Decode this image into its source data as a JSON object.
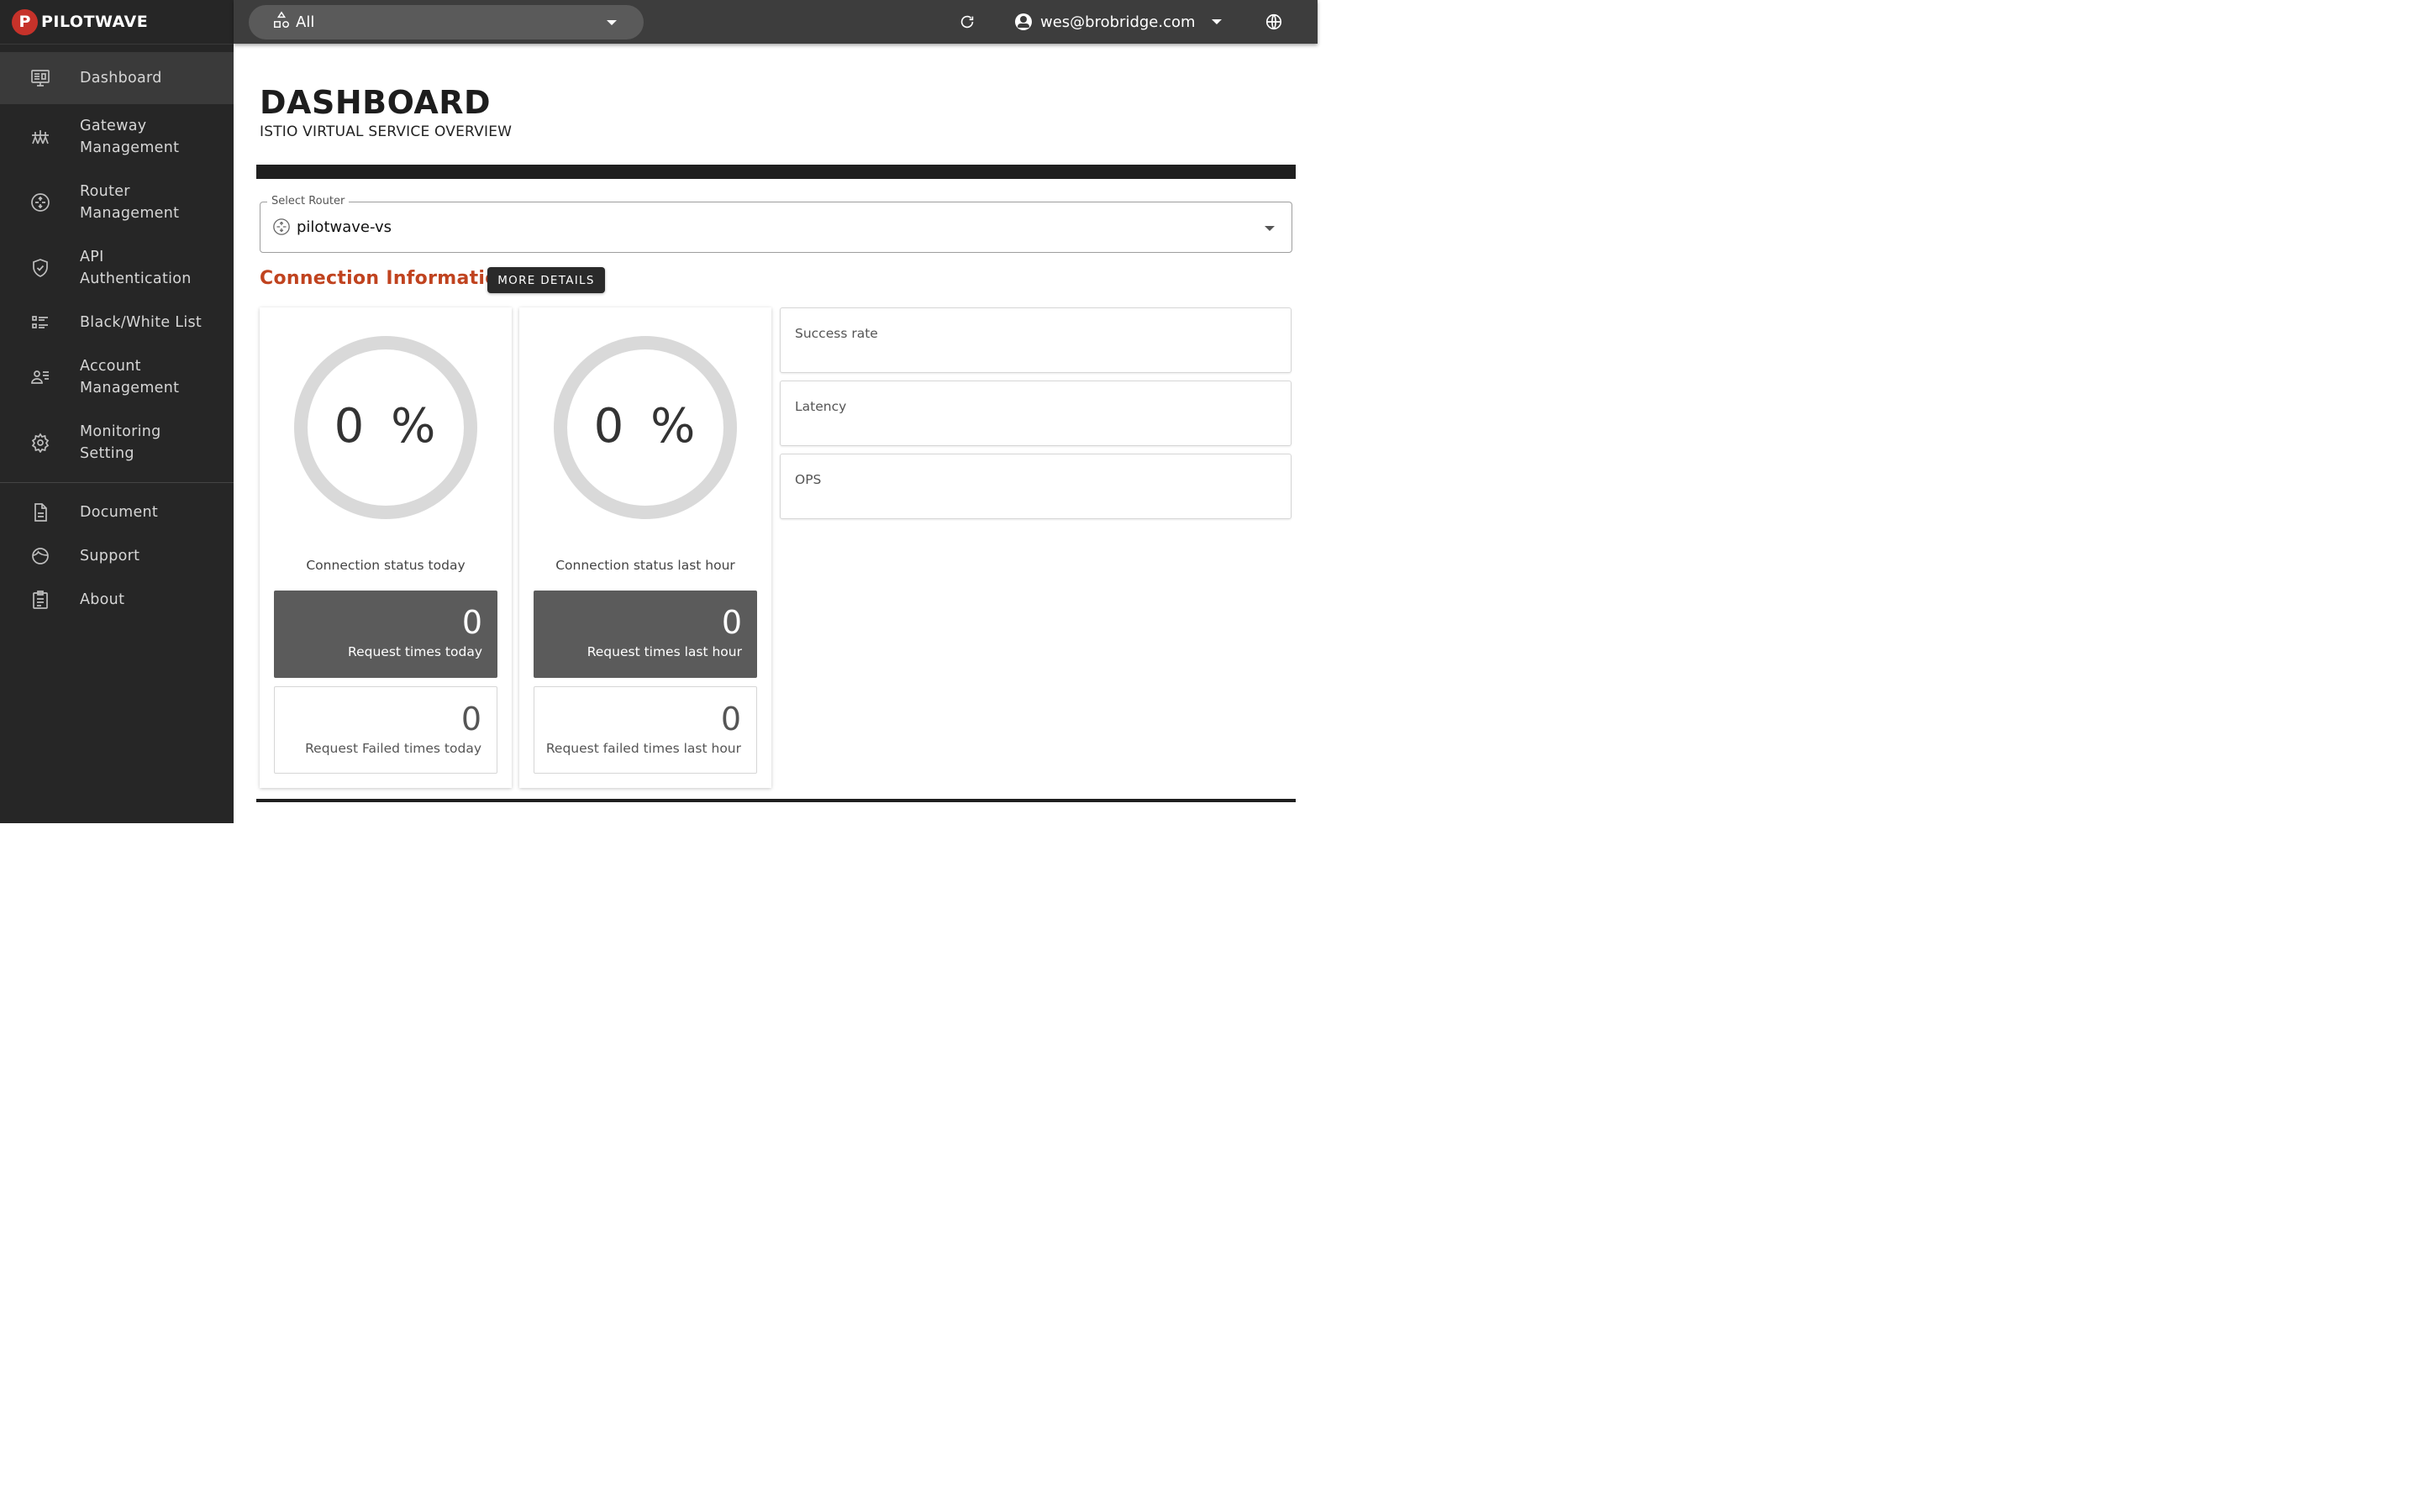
{
  "brand": {
    "logo_letter": "P",
    "name": "PILOTWAVE"
  },
  "sidebar": {
    "items": [
      {
        "label": "Dashboard",
        "icon": "monitor-icon",
        "active": true
      },
      {
        "label": "Gateway\nManagement",
        "icon": "gateway-icon"
      },
      {
        "label": "Router\nManagement",
        "icon": "router-icon"
      },
      {
        "label": "API\nAuthentication",
        "icon": "shield-icon"
      },
      {
        "label": "Black/White List",
        "icon": "list-icon"
      },
      {
        "label": "Account\nManagement",
        "icon": "account-list-icon"
      },
      {
        "label": "Monitoring\nSetting",
        "icon": "gear-icon"
      }
    ],
    "secondary": [
      {
        "label": "Document",
        "icon": "document-icon"
      },
      {
        "label": "Support",
        "icon": "support-icon"
      },
      {
        "label": "About",
        "icon": "clipboard-icon"
      }
    ]
  },
  "topbar": {
    "namespace": "All",
    "user_email": "wes@brobridge.com"
  },
  "page": {
    "title": "DASHBOARD",
    "subtitle": "ISTIO VIRTUAL SERVICE OVERVIEW"
  },
  "router_select": {
    "legend": "Select Router",
    "value": "pilotwave-vs"
  },
  "connection": {
    "title": "Connection Information",
    "more_button": "MORE DETAILS",
    "today": {
      "gauge_percent": 0,
      "gauge_text": "0 %",
      "caption": "Connection status today",
      "requests": "0",
      "requests_label": "Request times today",
      "failed": "0",
      "failed_label": "Request Failed times today"
    },
    "last_hour": {
      "gauge_percent": 0,
      "gauge_text": "0 %",
      "caption": "Connection status last hour",
      "requests": "0",
      "requests_label": "Request times last hour",
      "failed": "0",
      "failed_label": "Request failed times last hour"
    },
    "metrics": {
      "success_rate": "Success rate",
      "latency": "Latency",
      "ops": "OPS"
    }
  },
  "colors": {
    "sidebar_bg": "#262626",
    "topbar_bg": "#3d3d3d",
    "accent": "#c0431f",
    "logo": "#c6322a",
    "gauge_track": "#d9d9d9"
  }
}
